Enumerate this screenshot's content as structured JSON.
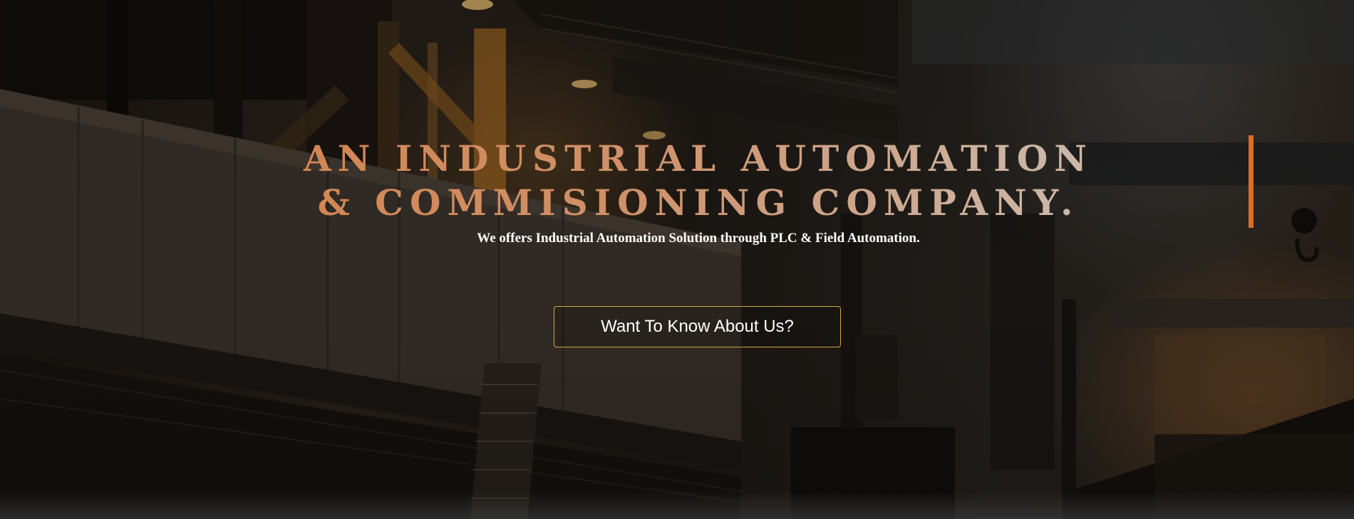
{
  "hero": {
    "headline_line1": "AN INDUSTRIAL AUTOMATION",
    "headline_line2": "& COMMISIONING COMPANY.",
    "subtitle": "We offers Industrial Automation Solution through PLC & Field Automation.",
    "cta_label": "Want To Know About Us?",
    "background_image": "industrial-factory-interior"
  },
  "colors": {
    "accent": "#d86f2a",
    "headline_gradient_start": "#d67c3e",
    "headline_gradient_end": "#c9c0b8",
    "cta_border": "#d9a43a",
    "text": "#ffffff"
  }
}
